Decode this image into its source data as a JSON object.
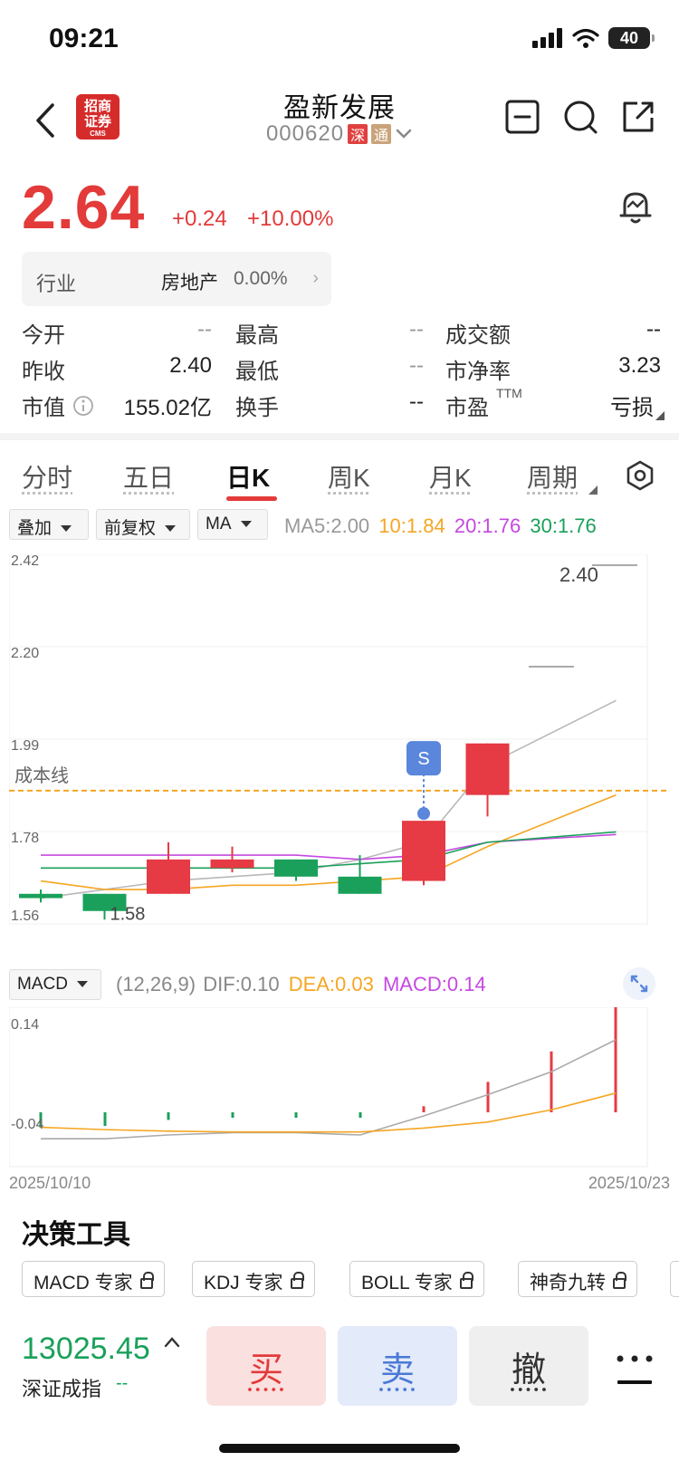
{
  "status": {
    "time": "09:21",
    "battery": "40"
  },
  "header": {
    "broker_logo_top": "招商",
    "broker_logo_mid": "证券",
    "broker_logo_sub": "CMS",
    "stock_name": "盈新发展",
    "stock_code": "000620",
    "tag_shen": "深",
    "tag_tong": "通"
  },
  "price": {
    "last": "2.64",
    "change": "+0.24",
    "change_pct": "+10.00%"
  },
  "industry": {
    "label": "行业",
    "name": "房地产",
    "pct": "0.00%"
  },
  "quote": {
    "open_label": "今开",
    "open": "--",
    "high_label": "最高",
    "high": "--",
    "turnover_amt_label": "成交额",
    "turnover_amt": "--",
    "prev_close_label": "昨收",
    "prev_close": "2.40",
    "low_label": "最低",
    "low": "--",
    "pb_label": "市净率",
    "pb": "3.23",
    "mcap_label": "市值",
    "mcap": "155.02亿",
    "turnover_label": "换手",
    "turnover": "--",
    "pe_label": "市盈",
    "pe_sup": "TTM",
    "pe": "亏损"
  },
  "tabs": [
    {
      "label": "分时"
    },
    {
      "label": "五日"
    },
    {
      "label": "日K"
    },
    {
      "label": "周K"
    },
    {
      "label": "月K"
    },
    {
      "label": "周期"
    }
  ],
  "controls": {
    "overlay": "叠加",
    "adjust": "前复权",
    "indicator": "MA",
    "ma5": "MA5:2.00",
    "ma10": "10:1.84",
    "ma20": "20:1.76",
    "ma30": "30:1.76",
    "macd_select": "MACD",
    "macd_params": "(12,26,9)",
    "dif": "DIF:0.10",
    "dea": "DEA:0.03",
    "macd_val": "MACD:0.14"
  },
  "colors": {
    "up": "#e63a44",
    "down": "#1aa05a",
    "ma5": "#b8b8b8",
    "ma10": "#f5a623",
    "ma20": "#c548e0",
    "ma30": "#1aa05a",
    "cost": "#f5a623",
    "signal": "#5a86db"
  },
  "chart_data": [
    {
      "type": "candlestick",
      "yticks": [
        "2.42",
        "2.20",
        "1.99",
        "1.78",
        "1.56"
      ],
      "ylim": [
        1.56,
        2.42
      ],
      "cost_line_label": "成本线",
      "cost_line": 1.87,
      "low_marker": "1.58",
      "high_marker": "2.40",
      "signal_label": "S",
      "candles": [
        {
          "o": 1.63,
          "c": 1.62,
          "h": 1.64,
          "l": 1.61
        },
        {
          "o": 1.63,
          "c": 1.59,
          "h": 1.63,
          "l": 1.57
        },
        {
          "o": 1.63,
          "c": 1.71,
          "h": 1.75,
          "l": 1.63
        },
        {
          "o": 1.69,
          "c": 1.71,
          "h": 1.74,
          "l": 1.68
        },
        {
          "o": 1.71,
          "c": 1.67,
          "h": 1.71,
          "l": 1.66
        },
        {
          "o": 1.67,
          "c": 1.63,
          "h": 1.72,
          "l": 1.63
        },
        {
          "o": 1.66,
          "c": 1.8,
          "h": 1.8,
          "l": 1.65
        },
        {
          "o": 1.86,
          "c": 1.98,
          "h": 1.98,
          "l": 1.81
        }
      ],
      "ma5": [
        1.62,
        1.64,
        1.66,
        1.67,
        1.68,
        1.71,
        1.75,
        1.93
      ],
      "ma10": [
        1.66,
        1.64,
        1.64,
        1.65,
        1.65,
        1.66,
        1.67,
        1.74
      ],
      "ma20": [
        1.72,
        1.72,
        1.72,
        1.72,
        1.72,
        1.71,
        1.72,
        1.75
      ],
      "ma30": [
        1.69,
        1.69,
        1.69,
        1.69,
        1.69,
        1.7,
        1.71,
        1.75
      ]
    },
    {
      "type": "bar",
      "yticks": [
        "0.14",
        "-0.04"
      ],
      "ylim": [
        -0.05,
        0.15
      ],
      "macd": [
        -0.02,
        -0.018,
        -0.01,
        -0.004,
        -0.003,
        -0.006,
        0.008,
        0.04,
        0.08,
        0.14
      ],
      "dif": [
        -0.03,
        -0.03,
        -0.025,
        -0.022,
        -0.022,
        -0.025,
        0.0,
        0.028,
        0.058,
        0.1
      ],
      "dea": [
        -0.015,
        -0.018,
        -0.02,
        -0.021,
        -0.021,
        -0.021,
        -0.016,
        -0.008,
        0.008,
        0.03
      ]
    }
  ],
  "dates": {
    "start": "2025/10/10",
    "end": "2025/10/23"
  },
  "tools": {
    "title": "决策工具",
    "chips": [
      {
        "label": "MACD 专家"
      },
      {
        "label": "KDJ 专家"
      },
      {
        "label": "BOLL 专家"
      },
      {
        "label": "神奇九转"
      }
    ]
  },
  "index": {
    "value": "13025.45",
    "name": "深证成指",
    "sub": "--"
  },
  "trade": {
    "buy": "买",
    "sell": "卖",
    "cancel": "撤"
  }
}
